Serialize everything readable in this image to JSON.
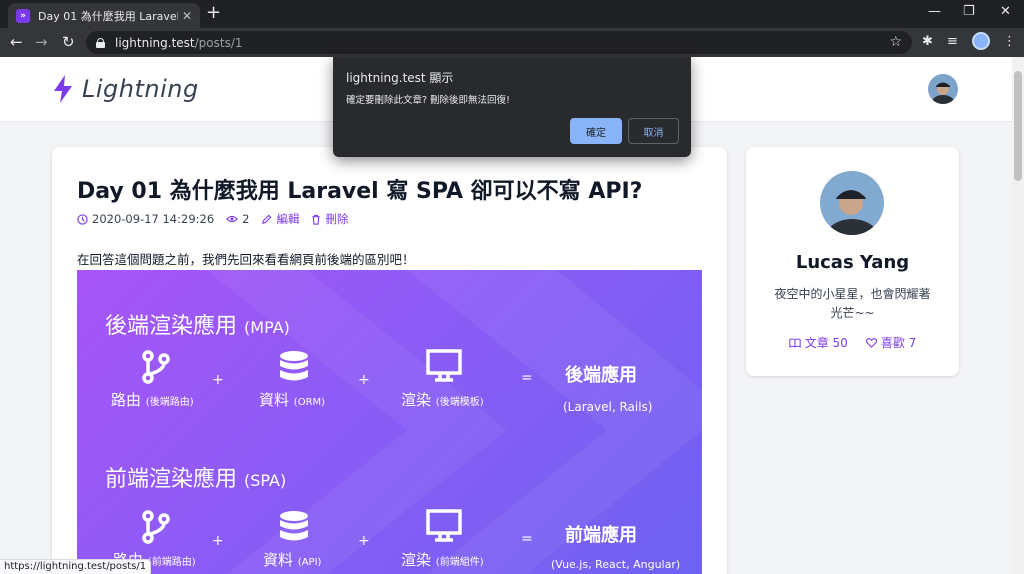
{
  "browser": {
    "tab_title": "Day 01 為什麼我用 Laravel 寫 SPA 卻可以不寫 API?",
    "tab_favicon": "»",
    "new_tab_label": "+",
    "url_host": "lightning.test",
    "url_path": "/posts/1",
    "status_url": "https://lightning.test/posts/1"
  },
  "icons": {
    "back": "←",
    "forward": "→",
    "reload": "↻",
    "star": "☆",
    "extensions": "✱",
    "media": "≡",
    "menu": "⋮",
    "minimize": "—",
    "restore": "❐",
    "close": "✕",
    "tab_close": "✕"
  },
  "site": {
    "logo_text": "Lightning",
    "accent_color": "#7c3aed"
  },
  "post": {
    "title": "Day 01 為什麼我用 Laravel 寫 SPA 卻可以不寫 API?",
    "date": "2020-09-17 14:29:26",
    "views": "2",
    "edit_label": "編輯",
    "delete_label": "刪除",
    "intro": "在回答這個問題之前，我們先回來看看網頁前後端的區別吧！"
  },
  "hero": {
    "mpa_heading": "後端渲染應用",
    "mpa_heading_tag": "(MPA)",
    "spa_heading": "前端渲染應用",
    "spa_heading_tag": "(SPA)",
    "mpa_route": "路由",
    "mpa_route_sub": "(後端路由)",
    "mpa_data": "資料",
    "mpa_data_sub": "(ORM)",
    "mpa_render": "渲染",
    "mpa_render_sub": "(後端模板)",
    "mpa_result": "後端應用",
    "mpa_result_sub": "(Laravel, Rails)",
    "spa_route": "路由",
    "spa_route_sub": "(前端路由)",
    "spa_data": "資料",
    "spa_data_sub": "(API)",
    "spa_render": "渲染",
    "spa_render_sub": "(前端組件)",
    "spa_result": "前端應用",
    "spa_result_sub": "(Vue.js, React, Angular)",
    "plus": "+",
    "equals": "="
  },
  "profile": {
    "name": "Lucas Yang",
    "bio": "夜空中的小星星，也會閃耀著光芒~~",
    "posts_label": "文章 50",
    "likes_label": "喜歡 7"
  },
  "dialog": {
    "title": "lightning.test 顯示",
    "message": "確定要刪除此文章? 刪除後即無法回復!",
    "ok_label": "確定",
    "cancel_label": "取消"
  }
}
